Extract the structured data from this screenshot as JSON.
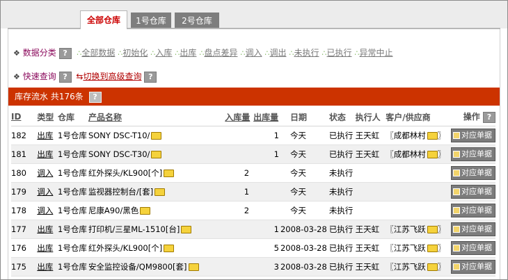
{
  "tabs": [
    {
      "label": "全部仓库",
      "active": true
    },
    {
      "label": "1号仓库",
      "active": false
    },
    {
      "label": "2号仓库",
      "active": false
    }
  ],
  "filter": {
    "heading": "数据分类",
    "help": "?",
    "items": [
      "全部数据",
      "初始化",
      "入库",
      "出库",
      "盘点差异",
      "调入",
      "调出",
      "未执行",
      "已执行",
      "异常中止"
    ]
  },
  "quick": {
    "heading": "快速查询",
    "help": "?",
    "switch_label": "切换到高级查询"
  },
  "banner": {
    "title": "库存流水",
    "count": "共176条",
    "help": "?"
  },
  "columns": {
    "id": "ID",
    "type": "类型",
    "warehouse": "仓库",
    "product": "产品名称",
    "in_qty": "入库量",
    "out_qty": "出库量",
    "date": "日期",
    "status": "状态",
    "operator": "执行人",
    "customer": "客户/供应商",
    "action": "操作"
  },
  "rows": [
    {
      "id": "182",
      "type": "出库",
      "warehouse": "1号仓库",
      "product": "SONY DSC-T10/",
      "in_qty": "",
      "out_qty": "1",
      "date": "今天",
      "status": "已执行",
      "operator": "王天虹",
      "customer": "〖成都林村",
      "action": "对应单据"
    },
    {
      "id": "181",
      "type": "出库",
      "warehouse": "1号仓库",
      "product": "SONY DSC-T30/",
      "in_qty": "",
      "out_qty": "1",
      "date": "今天",
      "status": "已执行",
      "operator": "王天虹",
      "customer": "〖成都林村",
      "action": "对应单据"
    },
    {
      "id": "180",
      "type": "调入",
      "warehouse": "1号仓库",
      "product": "红外探头/KL900[个]",
      "in_qty": "2",
      "out_qty": "",
      "date": "今天",
      "status": "未执行",
      "operator": "",
      "customer": "",
      "action": "对应单据"
    },
    {
      "id": "179",
      "type": "调入",
      "warehouse": "1号仓库",
      "product": "监视器控制台/[套]",
      "in_qty": "1",
      "out_qty": "",
      "date": "今天",
      "status": "未执行",
      "operator": "",
      "customer": "",
      "action": "对应单据"
    },
    {
      "id": "178",
      "type": "调入",
      "warehouse": "1号仓库",
      "product": "尼康A90/黑色",
      "in_qty": "2",
      "out_qty": "",
      "date": "今天",
      "status": "未执行",
      "operator": "",
      "customer": "",
      "action": "对应单据"
    },
    {
      "id": "177",
      "type": "出库",
      "warehouse": "1号仓库",
      "product": "打印机/三星ML-1510[台]",
      "in_qty": "",
      "out_qty": "1",
      "date": "2008-03-28",
      "status": "已执行",
      "operator": "王天虹",
      "customer": "〖江苏飞跃",
      "action": "对应单据"
    },
    {
      "id": "176",
      "type": "出库",
      "warehouse": "1号仓库",
      "product": "红外探头/KL900[个]",
      "in_qty": "",
      "out_qty": "5",
      "date": "2008-03-28",
      "status": "已执行",
      "operator": "王天虹",
      "customer": "〖江苏飞跃",
      "action": "对应单据"
    },
    {
      "id": "175",
      "type": "出库",
      "warehouse": "1号仓库",
      "product": "安全监控设备/QM9800[套]",
      "in_qty": "",
      "out_qty": "3",
      "date": "2008-03-28",
      "status": "已执行",
      "operator": "王天虹",
      "customer": "〖江苏飞跃",
      "action": "对应单据"
    }
  ]
}
